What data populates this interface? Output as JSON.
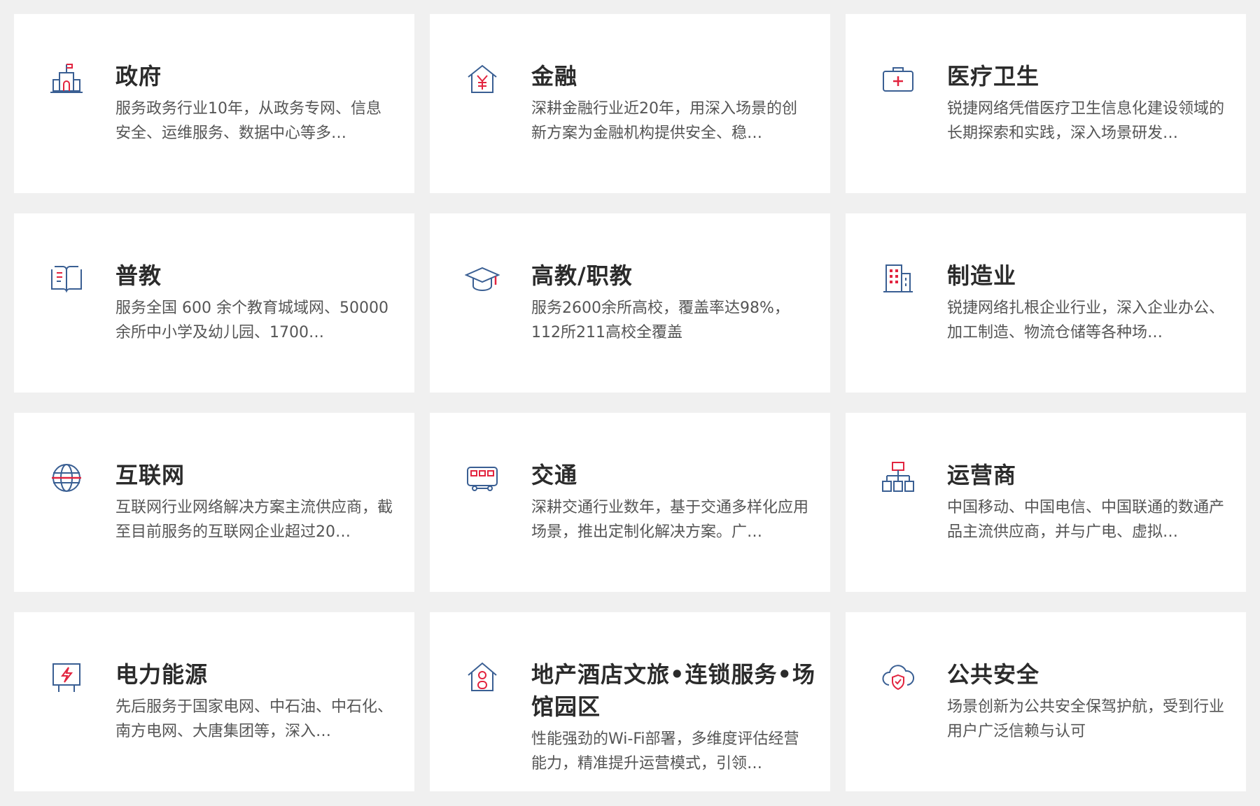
{
  "colors": {
    "page_bg": "#f0f0f0",
    "card_bg": "#ffffff",
    "icon_blue": "#3a5f93",
    "icon_red": "#e2243f",
    "title": "#2b2b2b",
    "text": "#555555"
  },
  "cards": [
    {
      "icon": "government-building-icon",
      "title": "政府",
      "desc": "服务政务行业10年，从政务专网、信息安全、运维服务、数据中心等多…"
    },
    {
      "icon": "finance-yuan-house-icon",
      "title": "金融",
      "desc": "深耕金融行业近20年，用深入场景的创新方案为金融机构提供安全、稳…"
    },
    {
      "icon": "medical-kit-icon",
      "title": "医疗卫生",
      "desc": "锐捷网络凭借医疗卫生信息化建设领域的长期探索和实践，深入场景研发…"
    },
    {
      "icon": "open-book-icon",
      "title": "普教",
      "desc": "服务全国 600 余个教育城域网、50000余所中小学及幼儿园、1700…"
    },
    {
      "icon": "graduation-cap-icon",
      "title": "高教/职教",
      "desc": "服务2600余所高校，覆盖率达98%，112所211高校全覆盖"
    },
    {
      "icon": "factory-building-icon",
      "title": "制造业",
      "desc": "锐捷网络扎根企业行业，深入企业办公、加工制造、物流仓储等各种场…"
    },
    {
      "icon": "globe-icon",
      "title": "互联网",
      "desc": "互联网行业网络解决方案主流供应商，截至目前服务的互联网企业超过20…"
    },
    {
      "icon": "bus-icon",
      "title": "交通",
      "desc": "深耕交通行业数年，基于交通多样化应用场景，推出定制化解决方案。广…"
    },
    {
      "icon": "network-hierarchy-icon",
      "title": "运营商",
      "desc": "中国移动、中国电信、中国联通的数通产品主流供应商，并与广电、虚拟…"
    },
    {
      "icon": "power-lightning-board-icon",
      "title": "电力能源",
      "desc": "先后服务于国家电网、中石油、中石化、南方电网、大唐集团等，深入…"
    },
    {
      "icon": "house-location-icon",
      "title": "地产酒店文旅•连锁服务•场馆园区",
      "desc": "性能强劲的Wi-Fi部署，多维度评估经营能力，精准提升运营模式，引领…"
    },
    {
      "icon": "cloud-shield-icon",
      "title": "公共安全",
      "desc": "场景创新为公共安全保驾护航，受到行业用户广泛信赖与认可"
    }
  ]
}
